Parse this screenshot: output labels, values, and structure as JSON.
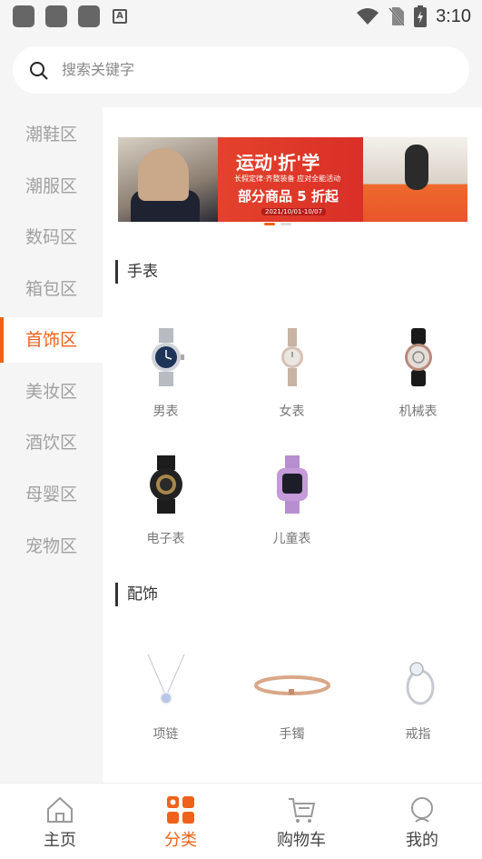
{
  "status": {
    "time": "3:10"
  },
  "search": {
    "placeholder": "搜索关键字"
  },
  "sidebar": {
    "items": [
      {
        "label": "潮鞋区",
        "active": false
      },
      {
        "label": "潮服区",
        "active": false
      },
      {
        "label": "数码区",
        "active": false
      },
      {
        "label": "箱包区",
        "active": false
      },
      {
        "label": "首饰区",
        "active": true
      },
      {
        "label": "美妆区",
        "active": false
      },
      {
        "label": "酒饮区",
        "active": false
      },
      {
        "label": "母婴区",
        "active": false
      },
      {
        "label": "宠物区",
        "active": false
      }
    ]
  },
  "banner": {
    "title": "运动'折'学",
    "subtitle": "长假定律·齐整装备 应对全能活动",
    "promo": "部分商品 5 折起",
    "date": "2021/10/01-10/07"
  },
  "sections": [
    {
      "title": "手表",
      "items": [
        {
          "label": "男表",
          "icon": "mens-watch-icon"
        },
        {
          "label": "女表",
          "icon": "womens-watch-icon"
        },
        {
          "label": "机械表",
          "icon": "mechanical-watch-icon"
        },
        {
          "label": "电子表",
          "icon": "digital-watch-icon"
        },
        {
          "label": "儿童表",
          "icon": "kids-watch-icon"
        }
      ]
    },
    {
      "title": "配饰",
      "items": [
        {
          "label": "项链",
          "icon": "necklace-icon"
        },
        {
          "label": "手镯",
          "icon": "bracelet-icon"
        },
        {
          "label": "戒指",
          "icon": "ring-icon"
        }
      ]
    }
  ],
  "tabbar": {
    "items": [
      {
        "label": "主页",
        "icon": "home-icon",
        "active": false
      },
      {
        "label": "分类",
        "icon": "category-icon",
        "active": true
      },
      {
        "label": "购物车",
        "icon": "cart-icon",
        "active": false
      },
      {
        "label": "我的",
        "icon": "profile-icon",
        "active": false
      }
    ]
  },
  "colors": {
    "accent": "#f0611a",
    "background": "#f5f5f5"
  }
}
